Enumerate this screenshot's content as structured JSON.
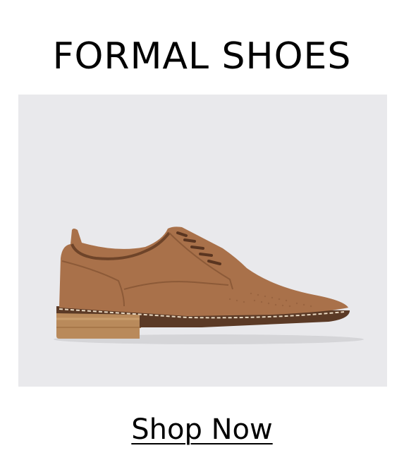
{
  "banner": {
    "title": "FORMAL SHOES",
    "cta_label": "Shop Now"
  },
  "product": {
    "image_icon": "brown-derby-shoe",
    "background_color": "#e9e9ec",
    "shoe_color": "#a9714a"
  }
}
